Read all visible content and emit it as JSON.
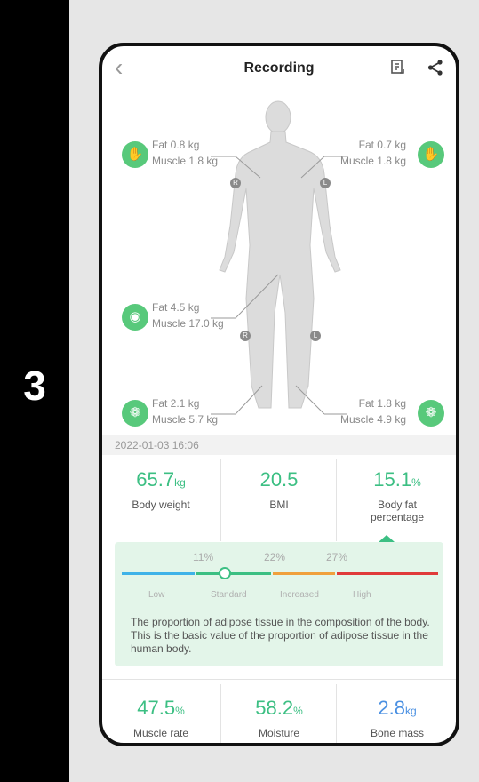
{
  "step_number": "3",
  "header": {
    "title": "Recording",
    "back_icon": "chevron-left-icon",
    "doc_icon": "document-icon",
    "share_icon": "share-icon"
  },
  "segments": {
    "left_arm": {
      "fat": "Fat 0.8 kg",
      "muscle": "Muscle 1.8 kg",
      "badge": "R"
    },
    "right_arm": {
      "fat": "Fat 0.7 kg",
      "muscle": "Muscle 1.8 kg",
      "badge": "L"
    },
    "trunk": {
      "fat": "Fat 4.5 kg",
      "muscle": "Muscle 17.0 kg"
    },
    "left_leg": {
      "fat": "Fat 2.1 kg",
      "muscle": "Muscle 5.7 kg",
      "badge": "R"
    },
    "right_leg": {
      "fat": "Fat 1.8 kg",
      "muscle": "Muscle 4.9 kg",
      "badge": "L"
    }
  },
  "timestamp": "2022-01-03 16:06",
  "metrics_top": [
    {
      "value": "65.7",
      "unit": "kg",
      "label": "Body weight"
    },
    {
      "value": "20.5",
      "unit": "",
      "label": "BMI"
    },
    {
      "value": "15.1",
      "unit": "%",
      "label": "Body fat percentage"
    }
  ],
  "fat_scale": {
    "thresholds": [
      "11%",
      "22%",
      "27%"
    ],
    "categories": [
      "Low",
      "Standard",
      "Increased",
      "High"
    ],
    "current_value": 15.1,
    "description": "The proportion of adipose tissue in the composition of the body. This is the basic value of the proportion of adipose tissue in the human body.",
    "colors": {
      "low": "#3fb2e8",
      "standard": "#3cbf83",
      "increased": "#f0a03c",
      "high": "#e03a3a"
    }
  },
  "metrics_bottom": [
    {
      "value": "47.5",
      "unit": "%",
      "label": "Muscle rate"
    },
    {
      "value": "58.2",
      "unit": "%",
      "label": "Moisture"
    },
    {
      "value": "2.8",
      "unit": "kg",
      "label": "Bone mass"
    }
  ],
  "colors": {
    "accent": "#3cbf83",
    "blue": "#4a90e2"
  }
}
